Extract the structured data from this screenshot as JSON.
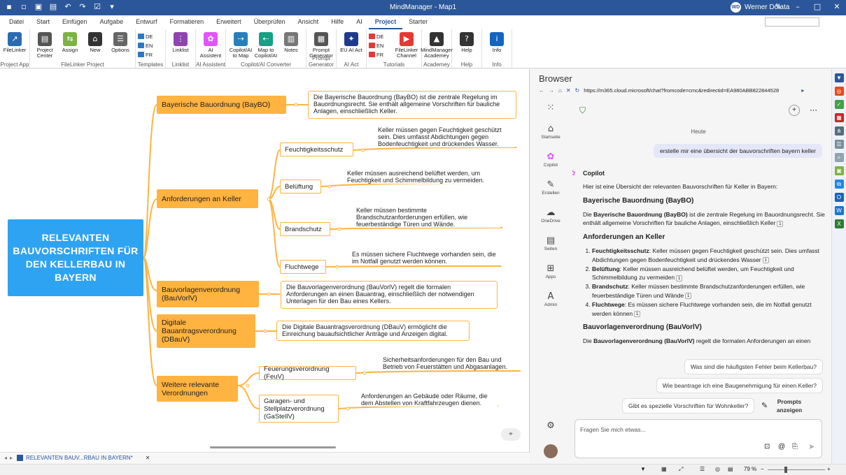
{
  "app": {
    "title": "MindManager - Map1",
    "user_initials": "WD",
    "user_name": "Werner Dolata"
  },
  "tabs": [
    "Datei",
    "Start",
    "Einfügen",
    "Aufgabe",
    "Entwurf",
    "Formatieren",
    "Erweitert",
    "Überprüfen",
    "Ansicht",
    "Hilfe",
    "AI",
    "Project",
    "Starter"
  ],
  "active_tab": "Project",
  "ribbon": {
    "groups": [
      {
        "label": "Project App",
        "buttons": [
          {
            "label": "FileLinker",
            "icon": "filelinker-icon",
            "color": "#2b6cb0"
          }
        ]
      },
      {
        "label": "FileLinker Project",
        "buttons": [
          {
            "label": "Project Center",
            "icon": "project-center-icon",
            "color": "#555"
          },
          {
            "label": "Assign",
            "icon": "assign-icon",
            "color": "#7cb342"
          },
          {
            "label": "New",
            "icon": "home-icon",
            "color": "#333"
          },
          {
            "label": "Options",
            "icon": "options-icon",
            "color": "#666"
          }
        ]
      },
      {
        "label": "Templates",
        "small": [
          "DE",
          "EN",
          "FR"
        ]
      },
      {
        "label": "Linklist",
        "buttons": [
          {
            "label": "Linklist",
            "icon": "linklist-icon",
            "color": "#8e44ad"
          }
        ]
      },
      {
        "label": "AI Assistent",
        "buttons": [
          {
            "label": "AI Assistent",
            "icon": "copilot-icon",
            "color": "#e056fd"
          }
        ]
      },
      {
        "label": "Copilot/AI Converter",
        "buttons": [
          {
            "label": "Copilot/AI to Map",
            "icon": "copilot-to-map-icon",
            "color": "#2980b9"
          },
          {
            "label": "Map to Copilot/AI",
            "icon": "map-to-copilot-icon",
            "color": "#16a085"
          },
          {
            "label": "Notes",
            "icon": "notes-icon",
            "color": "#777"
          }
        ]
      },
      {
        "label": "Prompt Generator",
        "buttons": [
          {
            "label": "Prompt Generator",
            "icon": "prompt-generator-icon",
            "color": "#555"
          }
        ]
      },
      {
        "label": "AI Act",
        "buttons": [
          {
            "label": "EU AI Act",
            "icon": "eu-flag-icon",
            "color": "#1e3a8a"
          }
        ]
      },
      {
        "label": "Tutorials",
        "small": [
          "DE",
          "EN",
          "FR"
        ],
        "buttons": [
          {
            "label": "FileLinker Channel",
            "icon": "youtube-icon",
            "color": "#e53935"
          }
        ]
      },
      {
        "label": "Academey",
        "buttons": [
          {
            "label": "MindManager Academey",
            "icon": "academy-icon",
            "color": "#333"
          }
        ]
      },
      {
        "label": "Help",
        "buttons": [
          {
            "label": "Help",
            "icon": "help-icon",
            "color": "#333"
          }
        ]
      },
      {
        "label": "Info",
        "buttons": [
          {
            "label": "Info",
            "icon": "info-icon",
            "color": "#1565c0"
          }
        ]
      }
    ]
  },
  "map": {
    "central": "RELEVANTEN BAUVORSCHRIFTEN FÜR DEN KELLERBAU IN BAYERN",
    "topics": {
      "bayBO": "Bayerische Bauordnung (BayBO)",
      "keller": "Anforderungen an Keller",
      "bauvorl": "Bauvorlagenverordnung (BauVorlV)",
      "dbauv": "Digitale Bauantragsverordnung (DBauV)",
      "weitere": "Weitere relevante Verordnungen"
    },
    "subtopics": {
      "feuchte": "Feuchtigkeitsschutz",
      "belueft": "Belüftung",
      "brand": "Brandschutz",
      "flucht": "Fluchtwege",
      "feuv": "Feuerungsverordnung (FeuV)",
      "garv": "Garagen- und Stellplatzverordnung (GaStellV)"
    },
    "notes": {
      "bayBO": "Die Bayerische Bauordnung (BayBO) ist die zentrale Regelung im Bauordnungsrecht. Sie enthält allgemeine Vorschriften für bauliche Anlagen, einschließlich Keller.",
      "feuchte": "Keller müssen gegen Feuchtigkeit geschützt sein. Dies umfasst Abdichtungen gegen Bodenfeuchtigkeit und drückendes Wasser.",
      "belueft": "Keller müssen ausreichend belüftet werden, um Feuchtigkeit und Schimmelbildung zu vermeiden.",
      "brand": "Keller müssen bestimmte Brandschutzanforderungen erfüllen, wie feuerbeständige Türen und Wände.",
      "flucht": "Es müssen sichere Fluchtwege vorhanden sein, die im Notfall genutzt werden können.",
      "bauvorl": "Die Bauvorlagenverordnung (BauVorlV) regelt die formalen Anforderungen an einen Bauantrag, einschließlich der notwendigen Unterlagen für den Bau eines Kellers.",
      "dbauv": "Die Digitale Bauantragsverordnung (DBauV) ermöglicht die Einreichung bauaufsichtlicher Anträge und Anzeigen digital.",
      "feuv": "Sicherheitsanforderungen für den Bau und Betrieb von Feuerstätten und Abgasanlagen.",
      "garv": "Anforderungen an Gebäude oder Räume, die dem Abstellen von Kraftfahrzeugen dienen."
    }
  },
  "doc_tab": "RELEVANTEN BAUV...RBAU IN BAYERN*",
  "zoom": "79 %",
  "browser": {
    "title": "Browser",
    "url": "https://m365.cloud.microsoft/chat?fromcode=cmc&redirectid=EA980ABB822844528",
    "nav": [
      "Startseite",
      "Copilot",
      "Erstellen",
      "OneDrive",
      "Seiten",
      "Apps",
      "Admin"
    ],
    "day": "Heute",
    "user_msg": "erstelle mir eine übersicht der bauvorschriften bayern keller",
    "bot_name": "Copilot",
    "intro": "Hier ist eine Übersicht der relevanten Bauvorschriften für Keller in Bayern:",
    "h1": "Bayerische Bauordnung (BayBO)",
    "p1_bold": "Bayerische Bauordnung (BayBO)",
    "p1_pre": "Die ",
    "p1_rest": " ist die zentrale Regelung im Bauordnungsrecht. Sie enthält allgemeine Vorschriften für bauliche Anlagen, einschließlich Keller",
    "h2": "Anforderungen an Keller",
    "items": [
      {
        "b": "Feuchtigkeitsschutz",
        "t": ": Keller müssen gegen Feuchtigkeit geschützt sein. Dies umfasst Abdichtungen gegen Bodenfeuchtigkeit und drückendes Wasser"
      },
      {
        "b": "Belüftung",
        "t": ": Keller müssen ausreichend belüftet werden, um Feuchtigkeit und Schimmelbildung zu vermeiden"
      },
      {
        "b": "Brandschutz",
        "t": ": Keller müssen bestimmte Brandschutzanforderungen erfüllen, wie feuerbeständige Türen und Wände"
      },
      {
        "b": "Fluchtwege",
        "t": ": Es müssen sichere Fluchtwege vorhanden sein, die im Notfall genutzt werden können"
      }
    ],
    "h3": "Bauvorlagenverordnung (BauVorlV)",
    "p3_pre": "Die ",
    "p3_bold": "Bauvorlagenverordnung (BauVorlV)",
    "p3_rest": " regelt die formalen Anforderungen an einen",
    "cite": "1",
    "suggestions": [
      "Was sind die häufigsten Fehler beim Kellerbau?",
      "Wie beantrage ich eine Baugenehmigung für einen Keller?",
      "Gibt es spezielle Vorschriften für Wohnkeller?"
    ],
    "prompts_label": "Prompts anzeigen",
    "input_placeholder": "Fragen Sie mich etwas..."
  }
}
